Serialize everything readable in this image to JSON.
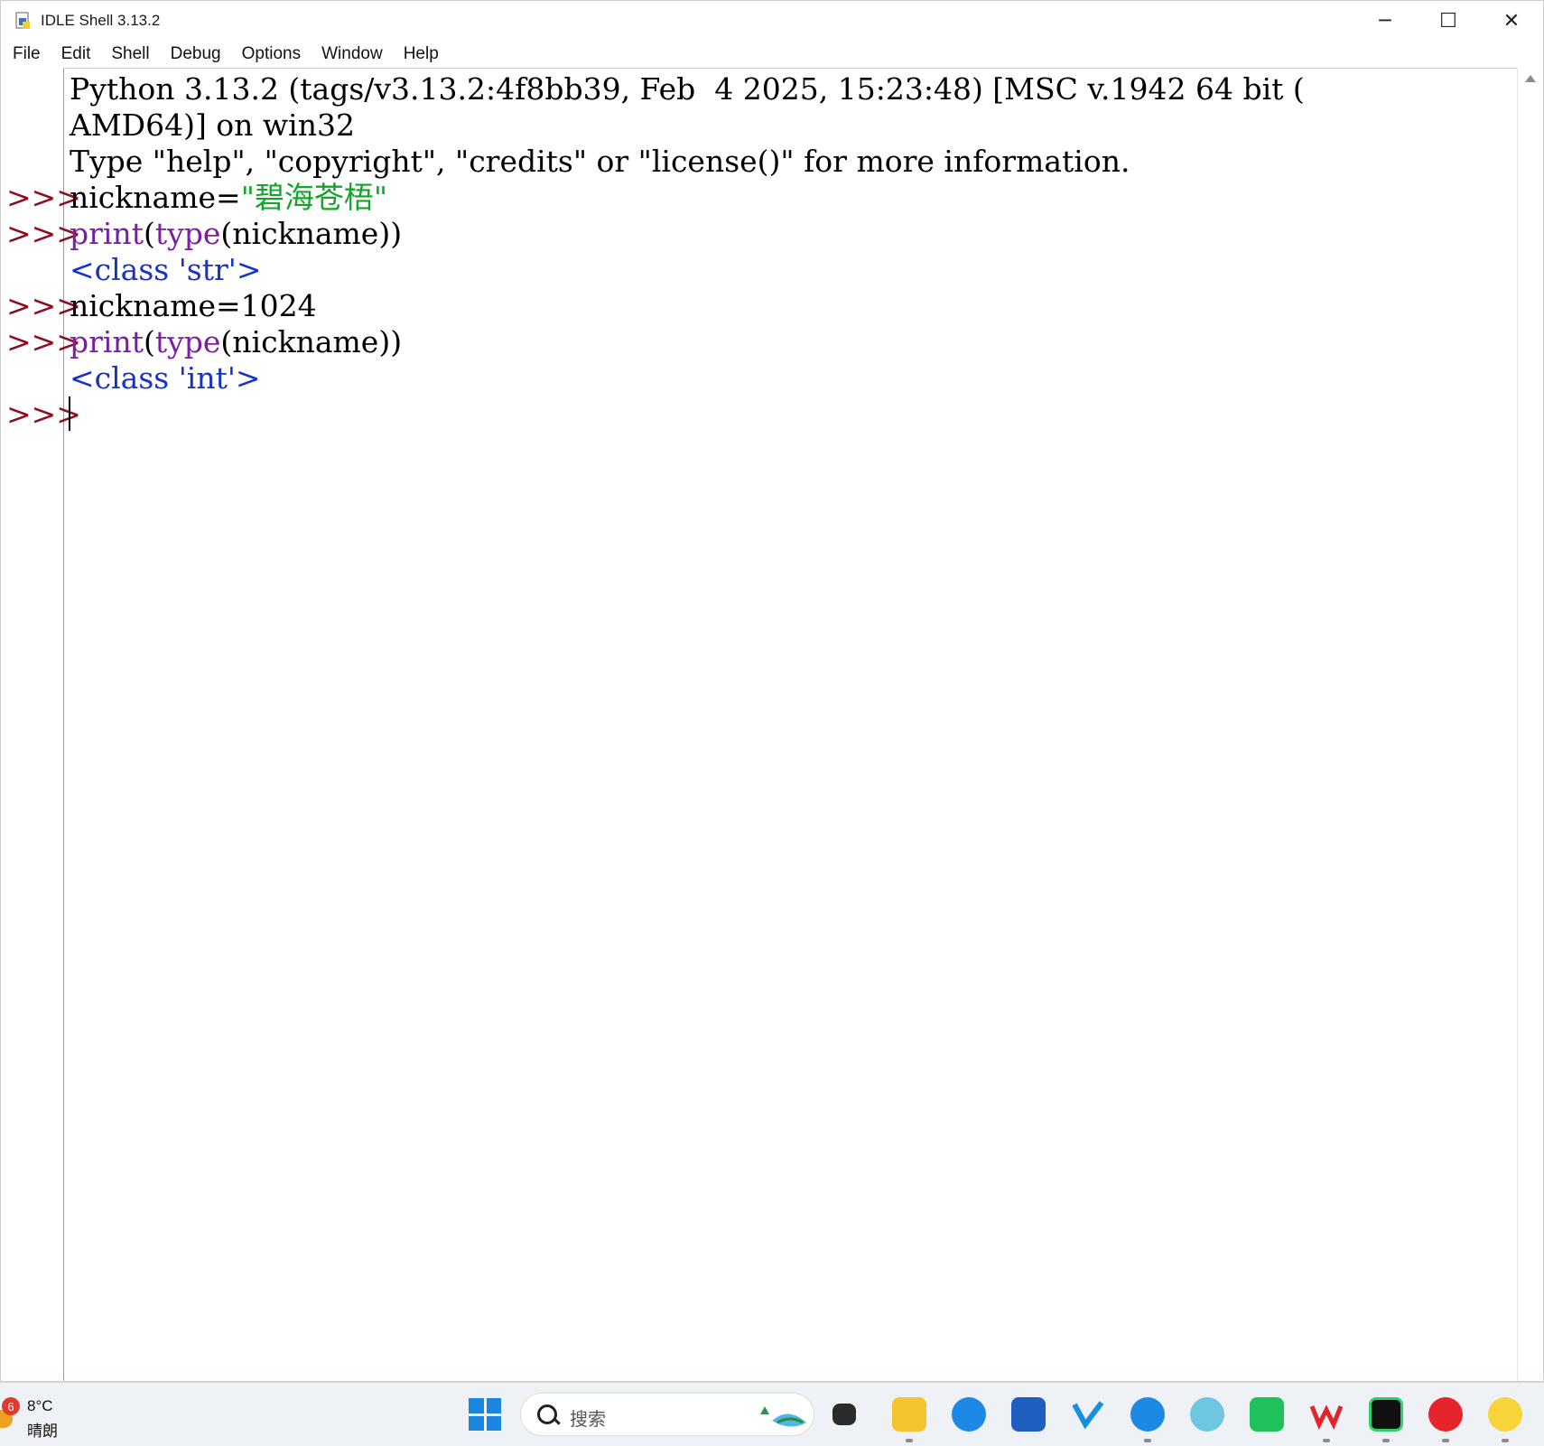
{
  "window": {
    "title": "IDLE Shell 3.13.2",
    "minimize_glyph": "─",
    "maximize_glyph": "☐",
    "close_glyph": "✕"
  },
  "menu": [
    "File",
    "Edit",
    "Shell",
    "Debug",
    "Options",
    "Window",
    "Help"
  ],
  "shell": {
    "banner_line1": "Python 3.13.2 (tags/v3.13.2:4f8bb39, Feb  4 2025, 15:23:48) [MSC v.1942 64 bit (",
    "banner_line2": "AMD64)] on win32",
    "banner_line3": "Type \"help\", \"copyright\", \"credits\" or \"license()\" for more information.",
    "prompt": ">>>",
    "cmd1_name": "nickname=",
    "cmd1_string": "\"碧海苍梧\"",
    "cmd2_builtin1": "print",
    "cmd2_paren1": "(",
    "cmd2_builtin2": "type",
    "cmd2_rest": "(nickname))",
    "out1": "<class 'str'>",
    "cmd3": "nickname=1024",
    "cmd4_builtin1": "print",
    "cmd4_paren1": "(",
    "cmd4_builtin2": "type",
    "cmd4_rest": "(nickname))",
    "out2": "<class 'int'>"
  },
  "taskbar": {
    "weather_badge": "6",
    "weather_temp": "8°C",
    "weather_desc": "晴朗",
    "search_placeholder": "搜索"
  },
  "colors": {
    "prompt": "#8b1022",
    "builtin": "#7a1fa2",
    "string": "#11a52a",
    "output": "#1632c9"
  }
}
